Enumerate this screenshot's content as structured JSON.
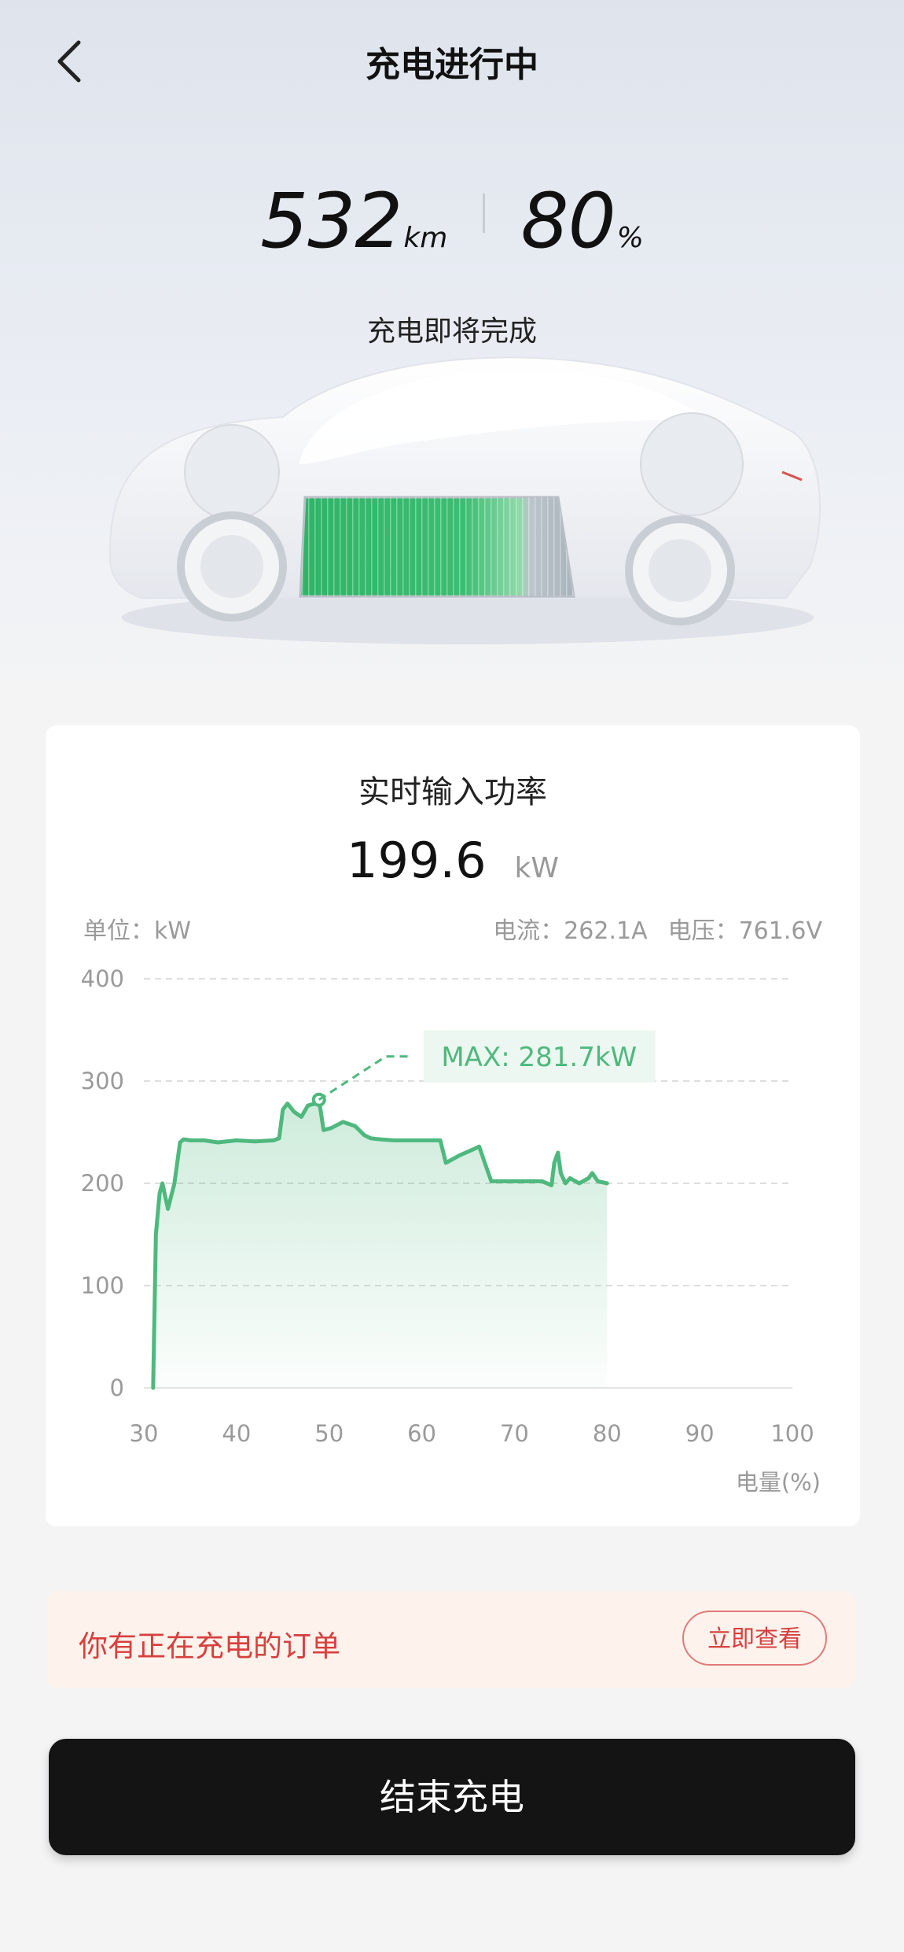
{
  "header": {
    "title": "充电进行中"
  },
  "status": {
    "range_value": "532",
    "range_unit": "km",
    "soc_value": "80",
    "soc_unit": "%",
    "message": "充电即将完成"
  },
  "power_card": {
    "title": "实时输入功率",
    "power_value": "199.6",
    "power_unit": "kW",
    "unit_label": "单位：kW",
    "current_label": "电流：262.1A",
    "voltage_label": "电压：761.6V"
  },
  "chart_data": {
    "type": "area",
    "xlabel": "电量(%)",
    "ylabel": "单位：kW",
    "xlim": [
      30,
      100
    ],
    "ylim": [
      0,
      400
    ],
    "xticks": [
      30,
      40,
      50,
      60,
      70,
      80,
      90,
      100
    ],
    "yticks": [
      0,
      100,
      200,
      300,
      400
    ],
    "grid": true,
    "color": "#4fb87e",
    "max_annotation": "MAX: 281.7kW",
    "max_point": {
      "x": 48.9,
      "y": 281.7
    },
    "x": [
      31,
      31.3,
      31.7,
      32,
      32.6,
      33.3,
      33.9,
      34.3,
      35,
      36.5,
      38,
      40,
      42,
      44,
      44.6,
      45,
      45.5,
      46.2,
      47,
      47.7,
      48.5,
      48.9,
      49.4,
      50.2,
      51.5,
      52.8,
      53.8,
      54.5,
      55.5,
      57,
      58,
      60,
      62,
      62.6,
      63,
      64,
      65.5,
      66.2,
      66.8,
      67.5,
      69,
      71,
      73,
      74,
      74.3,
      74.7,
      75,
      75.5,
      76,
      77,
      78,
      78.4,
      79,
      80
    ],
    "y": [
      0,
      150,
      190,
      200,
      175,
      200,
      240,
      243,
      242,
      242,
      240,
      242,
      241,
      242,
      244,
      272,
      278,
      270,
      265,
      276,
      278,
      281.7,
      252,
      254,
      260,
      256,
      247,
      244,
      243,
      242,
      242,
      242,
      242,
      220,
      222,
      227,
      233,
      236,
      220,
      202,
      202,
      202,
      202,
      198,
      220,
      230,
      210,
      200,
      205,
      200,
      205,
      210,
      202,
      200
    ]
  },
  "order_banner": {
    "text": "你有正在充电的订单",
    "button_label": "立即查看"
  },
  "end_button": {
    "label": "结束充电"
  },
  "icons": {
    "back": "chevron-left-icon",
    "car": "car-battery-illustration"
  }
}
